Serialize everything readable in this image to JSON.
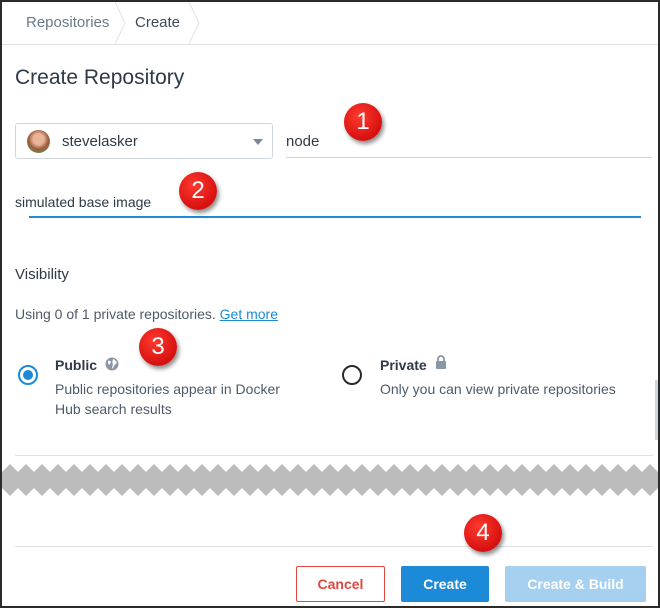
{
  "breadcrumb": {
    "items": [
      "Repositories",
      "Create"
    ]
  },
  "page": {
    "title": "Create Repository"
  },
  "namespace": {
    "value": "stevelasker"
  },
  "repo_name": {
    "value": "node"
  },
  "description": {
    "value": "simulated base image"
  },
  "visibility": {
    "title": "Visibility",
    "usage_text": "Using 0 of 1 private repositories.",
    "usage_link": "Get more",
    "public": {
      "label": "Public",
      "description": "Public repositories appear in Docker Hub search results",
      "selected": true
    },
    "private": {
      "label": "Private",
      "description": "Only you can view private repositories",
      "selected": false
    }
  },
  "buttons": {
    "cancel": "Cancel",
    "create": "Create",
    "create_build": "Create & Build"
  },
  "callouts": [
    "1",
    "2",
    "3",
    "4"
  ],
  "colors": {
    "accent": "#1c8ad7",
    "danger": "#e0473f",
    "callout": "#d61010"
  },
  "icons": {
    "public": "globe-icon",
    "private": "lock-icon",
    "select": "chevron-down-icon"
  }
}
